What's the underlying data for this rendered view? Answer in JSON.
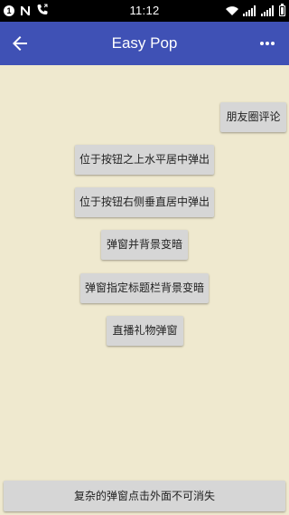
{
  "status_bar": {
    "notification_count": "1",
    "time": "11:12"
  },
  "app_bar": {
    "title": "Easy Pop"
  },
  "buttons": {
    "moments_comment": "朋友圈评论",
    "below_center": "位于按钮之上水平居中弹出",
    "right_vertical_center": "位于按钮右侧垂直居中弹出",
    "dim_background": "弹窗并背景变暗",
    "dim_below_title": "弹窗指定标题栏背景变暗",
    "live_gift": "直播礼物弹窗",
    "complex_outside_no_dismiss": "复杂的弹窗点击外面不可消失"
  },
  "colors": {
    "app_bar": "#3f51b5",
    "background": "#efe9cf",
    "button": "#d6d6d6",
    "status_bar": "#000000"
  }
}
